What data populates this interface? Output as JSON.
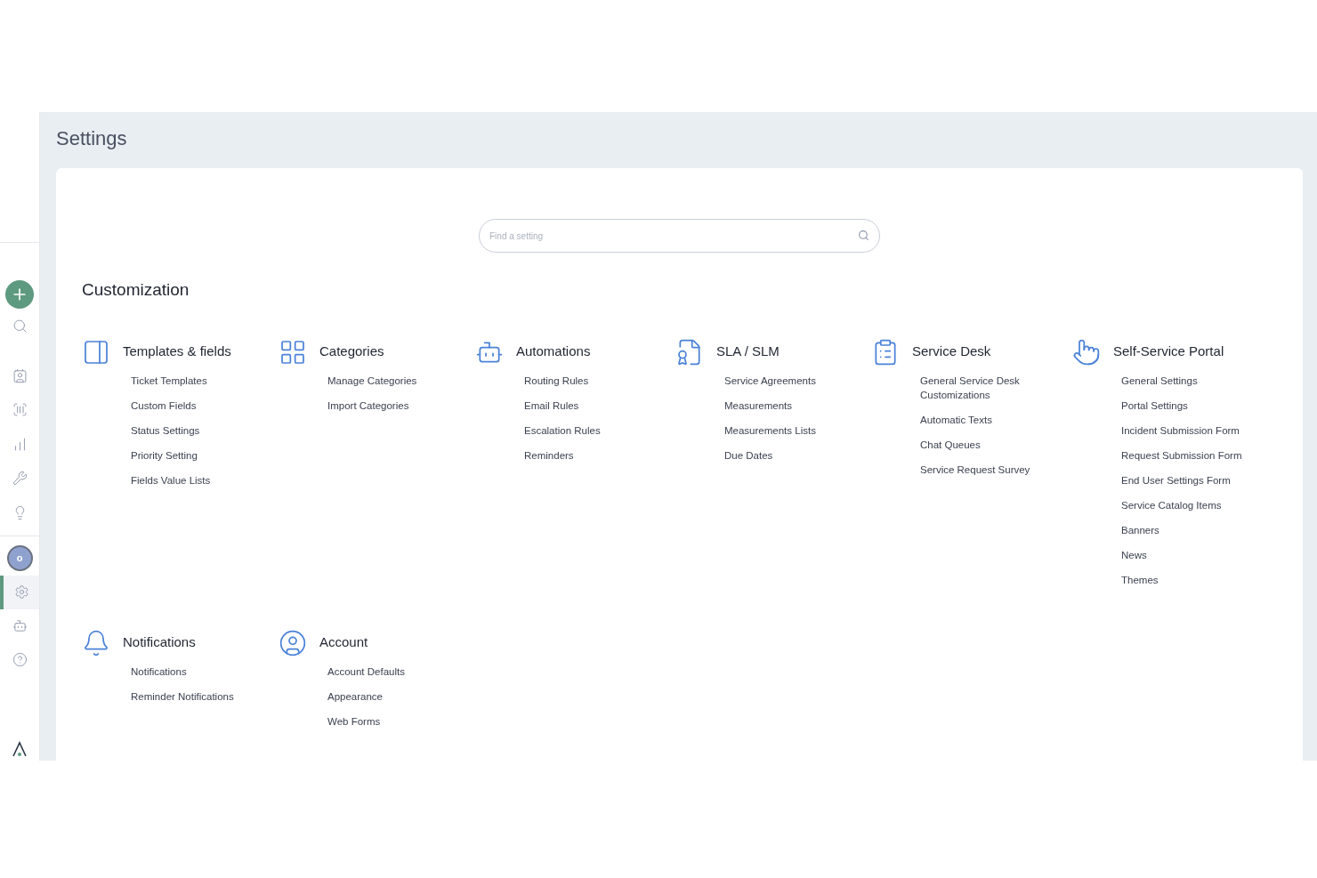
{
  "sidebar": {
    "items": [
      {
        "selected": false
      },
      {
        "selected": false
      },
      {
        "selected": false
      },
      {
        "selected": false
      },
      {
        "selected": false
      },
      {
        "selected": false
      },
      {
        "selected": false
      }
    ],
    "avatar": {
      "initial": "o"
    },
    "bottom_items": [
      {
        "selected": true
      },
      {
        "selected": false
      },
      {
        "selected": false
      }
    ]
  },
  "page": {
    "title": "Settings"
  },
  "search": {
    "placeholder": "Find a setting"
  },
  "section_title": "Customization",
  "groups": [
    {
      "title": "Templates & fields",
      "items": [
        "Ticket Templates",
        "Custom Fields",
        "Status Settings",
        "Priority Setting",
        "Fields Value Lists"
      ]
    },
    {
      "title": "Categories",
      "items": [
        "Manage Categories",
        "Import Categories"
      ]
    },
    {
      "title": "Automations",
      "items": [
        "Routing Rules",
        "Email Rules",
        "Escalation Rules",
        "Reminders"
      ]
    },
    {
      "title": "SLA / SLM",
      "items": [
        "Service Agreements",
        "Measurements",
        "Measurements Lists",
        "Due Dates"
      ]
    },
    {
      "title": "Service Desk",
      "items": [
        "General Service Desk Customizations",
        "Automatic Texts",
        "Chat Queues",
        "Service Request Survey"
      ]
    },
    {
      "title": "Self-Service Portal",
      "items": [
        "General Settings",
        "Portal Settings",
        "Incident Submission Form",
        "Request Submission Form",
        "End User Settings Form",
        "Service Catalog Items",
        "Banners",
        "News",
        "Themes"
      ]
    },
    {
      "title": "Notifications",
      "items": [
        "Notifications",
        "Reminder Notifications"
      ]
    },
    {
      "title": "Account",
      "items": [
        "Account Defaults",
        "Appearance",
        "Web Forms"
      ]
    }
  ]
}
